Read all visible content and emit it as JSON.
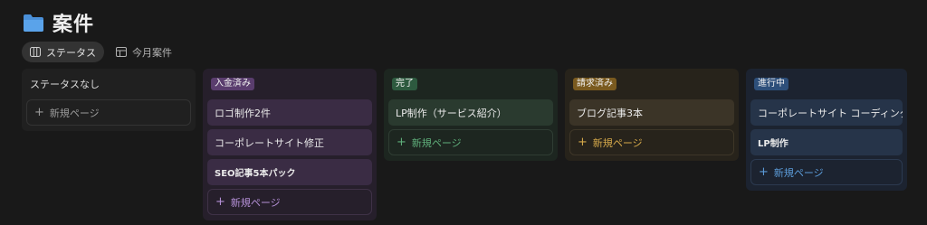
{
  "page": {
    "title": "案件",
    "icon": "folder-icon"
  },
  "tabs": [
    {
      "label": "ステータス",
      "icon": "board-icon",
      "active": true
    },
    {
      "label": "今月案件",
      "icon": "table-icon",
      "active": false
    }
  ],
  "add_label": "新規ページ",
  "columns": [
    {
      "name": "ステータスなし",
      "badge": false,
      "cards": []
    },
    {
      "name": "入金済み",
      "badge": true,
      "badge_color": "#5a3d6e",
      "accent": "#b48fd6",
      "cards": [
        "ロゴ制作2件",
        "コーポレートサイト修正",
        "SEO記事5本パック"
      ]
    },
    {
      "name": "完了",
      "badge": true,
      "badge_color": "#2d5a3f",
      "accent": "#5fae7a",
      "cards": [
        "LP制作（サービス紹介）"
      ]
    },
    {
      "name": "請求済み",
      "badge": true,
      "badge_color": "#7a5a1f",
      "accent": "#d4a84a",
      "cards": [
        "ブログ記事3本"
      ]
    },
    {
      "name": "進行中",
      "badge": true,
      "badge_color": "#2d4f7a",
      "accent": "#5b9bd8",
      "cards": [
        "コーポレートサイト コーディング",
        "LP制作"
      ]
    }
  ]
}
